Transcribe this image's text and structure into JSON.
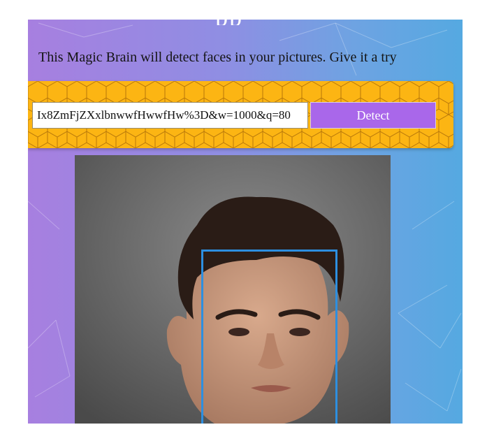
{
  "header": {
    "title_fragment": "pp"
  },
  "instructions": "This Magic Brain will detect faces in your pictures. Give it a try",
  "form": {
    "url_value": "Ix8ZmFjZXxlbnwwfHwwfHw%3D&w=1000&q=80",
    "detect_label": "Detect"
  },
  "colors": {
    "panel": "#fcb513",
    "button": "#a967ea",
    "box": "#2d8fe0"
  },
  "icons": {
    "panel_pattern": "honeycomb-pattern"
  },
  "image": {
    "description": ""
  }
}
